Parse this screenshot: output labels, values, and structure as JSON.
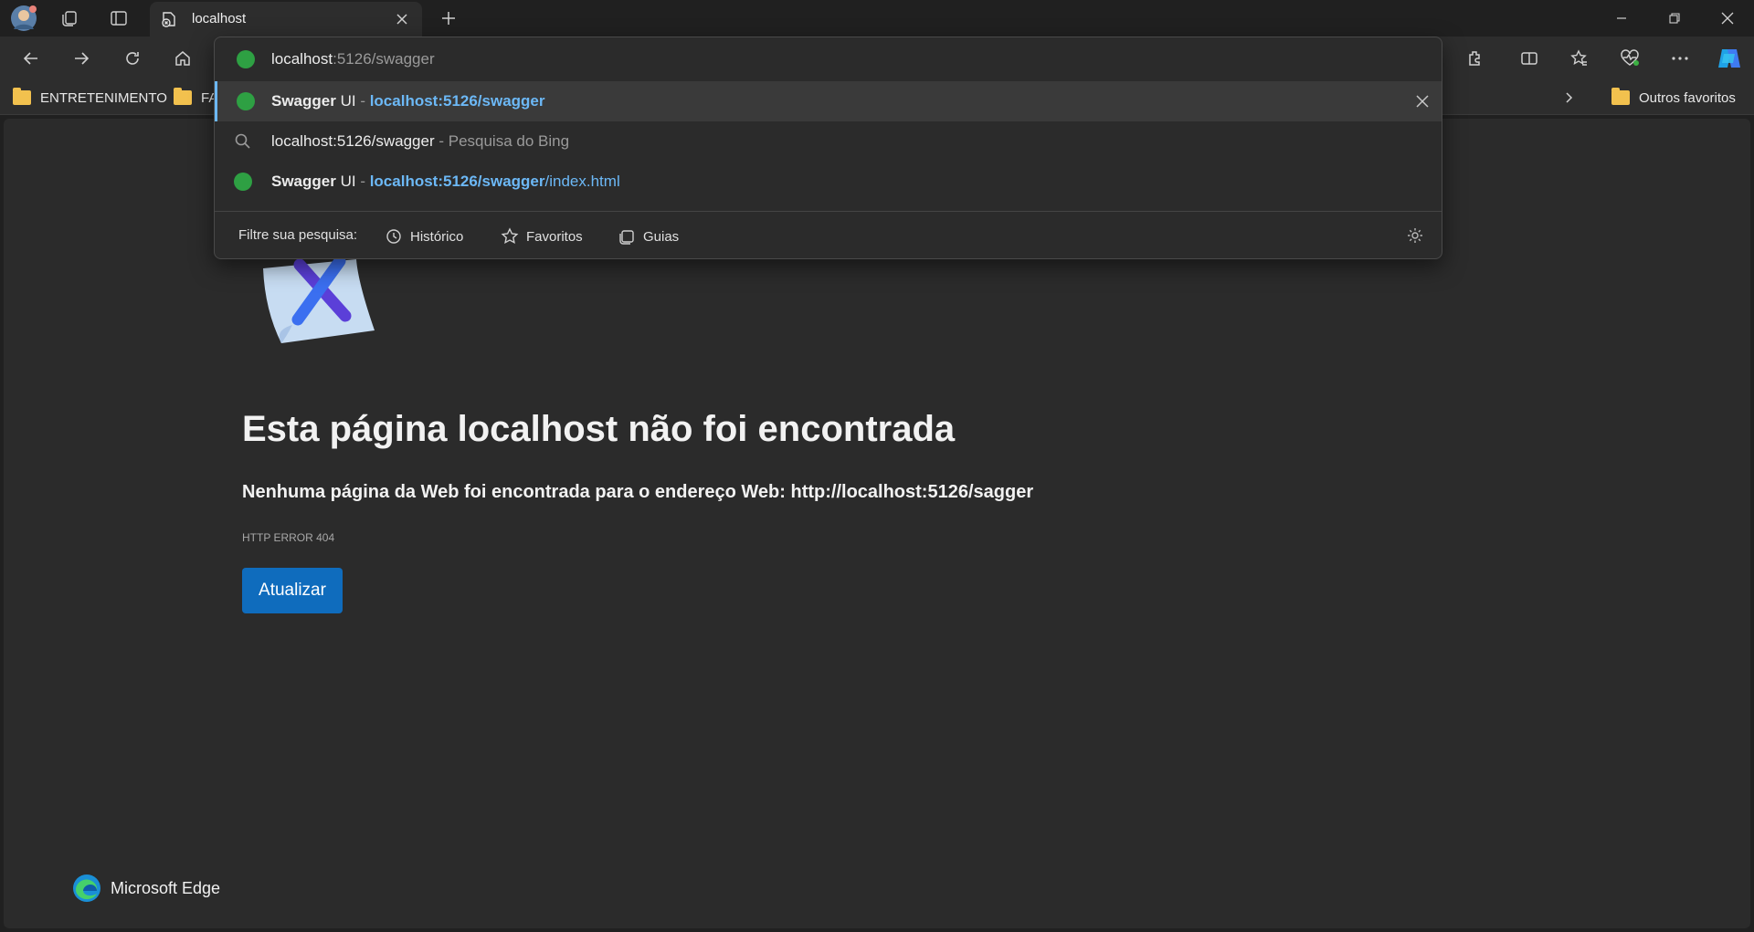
{
  "tab": {
    "title": "localhost"
  },
  "address_bar": {
    "value_host": "localhost",
    "value_path": ":5126/swagger"
  },
  "suggestions": [
    {
      "title": "Swagger",
      "title_suffix": " UI",
      "separator": " - ",
      "url_bold": "localhost:5126/swagger",
      "url_rest": ""
    },
    {
      "query": "localhost:5126/swagger",
      "separator": " - ",
      "source": "Pesquisa do Bing"
    },
    {
      "title": "Swagger",
      "title_suffix": " UI",
      "separator": " - ",
      "url_bold": "localhost:5126/swagger",
      "url_rest": "/index.html"
    }
  ],
  "filter": {
    "label": "Filtre sua pesquisa:",
    "history": "Histórico",
    "favorites": "Favoritos",
    "tabs": "Guias"
  },
  "favorites_bar": {
    "items": [
      "ENTRETENIMENTO",
      "FA"
    ],
    "other": "Outros favoritos"
  },
  "error_page": {
    "title": "Esta página localhost não foi encontrada",
    "description_prefix": "Nenhuma página da Web foi encontrada para o endereço Web: ",
    "description_url": "http://localhost:5126/sagger",
    "code": "HTTP ERROR 404",
    "button": "Atualizar",
    "brand": "Microsoft Edge"
  },
  "colors": {
    "accent": "#0f6cbd",
    "link": "#6cb8f6",
    "background": "#2b2b2b"
  },
  "icons": [
    "profile-avatar",
    "collections-icon",
    "tab-actions-icon",
    "page-error-icon",
    "close-icon",
    "new-tab-icon",
    "minimize-icon",
    "restore-icon",
    "back-icon",
    "forward-icon",
    "refresh-icon",
    "home-icon",
    "globe-icon",
    "search-icon",
    "settings-icon",
    "extensions-icon",
    "split-screen-icon",
    "favorites-icon",
    "browser-essentials-icon",
    "more-icon",
    "copilot-icon",
    "folder-icon",
    "chevron-right-icon"
  ]
}
